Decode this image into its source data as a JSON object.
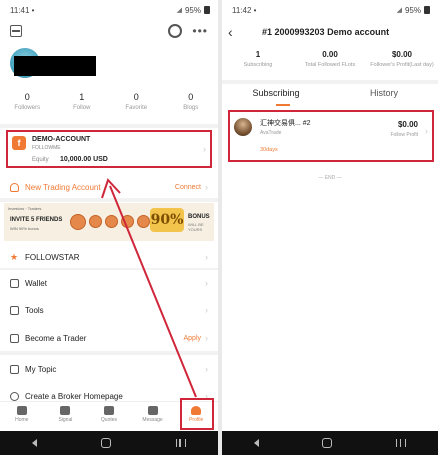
{
  "left": {
    "status": {
      "time": "11:41",
      "dot": "•",
      "battery": "95%"
    },
    "stats": [
      {
        "value": "0",
        "label": "Followers"
      },
      {
        "value": "1",
        "label": "Follow"
      },
      {
        "value": "0",
        "label": "Favorite"
      },
      {
        "value": "0",
        "label": "Blogs"
      }
    ],
    "demo": {
      "name": "DEMO-ACCOUNT",
      "broker": "FOLLOWME",
      "equity_label": "Equity",
      "equity_value": "10,000.00 USD"
    },
    "new_account": {
      "label": "New Trading Account",
      "action": "Connect"
    },
    "banner": {
      "top": "Investors · Traders",
      "title": "INVITE 5 FRIENDS",
      "sub": "WIN 90% bonus",
      "big": "90%",
      "bonus": "BONUS",
      "bonus_sub": "WILL BE YOURS"
    },
    "menu": [
      {
        "label": "FOLLOWSTAR",
        "action": ""
      },
      {
        "label": "Wallet",
        "action": ""
      },
      {
        "label": "Tools",
        "action": ""
      },
      {
        "label": "Become a Trader",
        "action": "Apply"
      },
      {
        "label": "My Topic",
        "action": ""
      },
      {
        "label": "Create a Broker Homepage",
        "action": ""
      }
    ],
    "tabs": [
      {
        "label": "Home"
      },
      {
        "label": "Signal"
      },
      {
        "label": "Quotes"
      },
      {
        "label": "Message"
      },
      {
        "label": "Profile"
      }
    ],
    "colors": {
      "accent": "#f07a34",
      "highlight": "#d0263a"
    }
  },
  "right": {
    "status": {
      "time": "11:42",
      "dot": "•",
      "battery": "95%"
    },
    "title": "#1 2000993203 Demo account",
    "stats": [
      {
        "value": "1",
        "label": "Subscribing"
      },
      {
        "value": "0.00",
        "label": "Total Followed FLots"
      },
      {
        "value": "$0.00",
        "label": "Follower's Profit(Last day)"
      }
    ],
    "tabs": [
      "Subscribing",
      "History"
    ],
    "trade": {
      "name": "汇神交易俱... #2",
      "broker": "AvaTrade",
      "days": "30days",
      "value": "$0.00",
      "value_label": "Follow Profit"
    },
    "end": "— END —"
  }
}
